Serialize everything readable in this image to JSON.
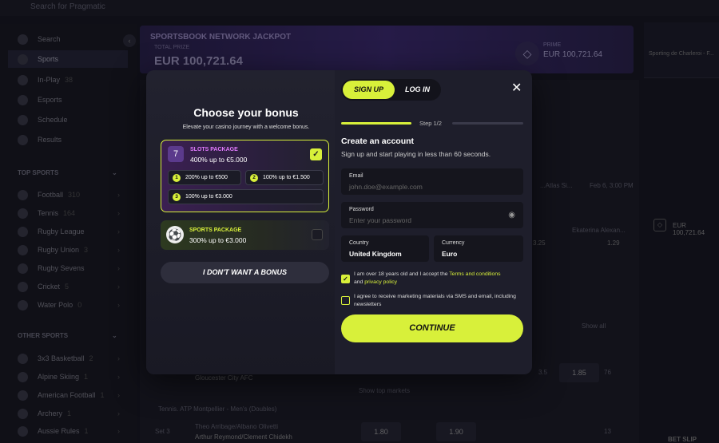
{
  "topbar": {
    "search_placeholder": "Search for Pragmatic"
  },
  "sidebar": {
    "items": [
      {
        "label": "Search",
        "count": ""
      },
      {
        "label": "Sports",
        "count": ""
      },
      {
        "label": "In-Play",
        "count": "38"
      },
      {
        "label": "Esports",
        "count": ""
      },
      {
        "label": "Schedule",
        "count": ""
      },
      {
        "label": "Results",
        "count": ""
      }
    ],
    "top_sports_header": "TOP SPORTS",
    "top_sports": [
      {
        "label": "Football",
        "count": "310"
      },
      {
        "label": "Tennis",
        "count": "164"
      },
      {
        "label": "Rugby League",
        "count": ""
      },
      {
        "label": "Rugby Union",
        "count": "3"
      },
      {
        "label": "Rugby Sevens",
        "count": ""
      },
      {
        "label": "Cricket",
        "count": "5"
      },
      {
        "label": "Water Polo",
        "count": "0"
      }
    ],
    "other_sports_header": "OTHER SPORTS",
    "other_sports": [
      {
        "label": "3x3 Basketball",
        "count": "2"
      },
      {
        "label": "Alpine Skiing",
        "count": "1"
      },
      {
        "label": "American Football",
        "count": "1"
      },
      {
        "label": "Archery",
        "count": "1"
      },
      {
        "label": "Aussie Rules",
        "count": "1"
      }
    ]
  },
  "jackpot": {
    "title": "SPORTSBOOK NETWORK JACKPOT",
    "sub": "TOTAL PRIZE",
    "amount": "EUR 100,721.64",
    "prime_label": "PRIME",
    "prime_amount": "EUR 100,721.64"
  },
  "background": {
    "right_match": "Sporting de Charleroi - F...",
    "right_jackpot": "EUR 100,721.64",
    "event_text": "...Atlas Si...",
    "event_date": "Feb 6, 3:00 PM",
    "player_name": "Ekaterina Alexan...",
    "odd_a": "3.25",
    "odd_b": "1.29",
    "show_all": "Show all",
    "team": "Gloucester City AFC",
    "odd_c": "3.5",
    "odd_d": "1.85",
    "odd_e": "76",
    "show_top": "Show top markets",
    "league": "Tennis. ATP Montpellier - Men's (Doubles)",
    "doubles_1": "Theo Arribage/Albano Olivetti",
    "doubles_2": "Arthur Reymond/Clement Chidekh",
    "set_label": "Set 3",
    "odd_f": "1.80",
    "odd_g": "1.90",
    "odd_h": "13",
    "bet_slip": "BET SLIP"
  },
  "modal": {
    "bonus_title": "Choose your bonus",
    "bonus_sub": "Elevate your casino journey with a welcome bonus.",
    "slots": {
      "name": "SLOTS PACKAGE",
      "desc": "400% up to €5.000",
      "offers": [
        {
          "num": "1",
          "text": "200% up to €500"
        },
        {
          "num": "2",
          "text": "100% up to €1.500"
        },
        {
          "num": "3",
          "text": "100% up to €3.000"
        }
      ]
    },
    "sports": {
      "name": "SPORTS PACKAGE",
      "desc": "300% up to €3.000"
    },
    "no_bonus": "I DON'T WANT A BONUS",
    "tab_signup": "SIGN UP",
    "tab_login": "LOG IN",
    "step": "Step 1/2",
    "create_title": "Create an account",
    "create_sub": "Sign up and start playing in less than 60 seconds.",
    "email_label": "Email",
    "email_placeholder": "john.doe@example.com",
    "password_label": "Password",
    "password_placeholder": "Enter your password",
    "country_label": "Country",
    "country_value": "United Kingdom",
    "currency_label": "Currency",
    "currency_value": "Euro",
    "terms_pre": "I am over 18 years old and I accept the ",
    "terms_link": "Terms and conditions",
    "terms_and": "and ",
    "privacy_link": "privacy policy",
    "marketing": "I agree to receive marketing materials via SMS and email, including newsletters",
    "continue": "CONTINUE"
  },
  "colors": {
    "accent": "#d8f03a",
    "modal_bg": "#1e1e2b",
    "page_bg": "#15151f"
  }
}
